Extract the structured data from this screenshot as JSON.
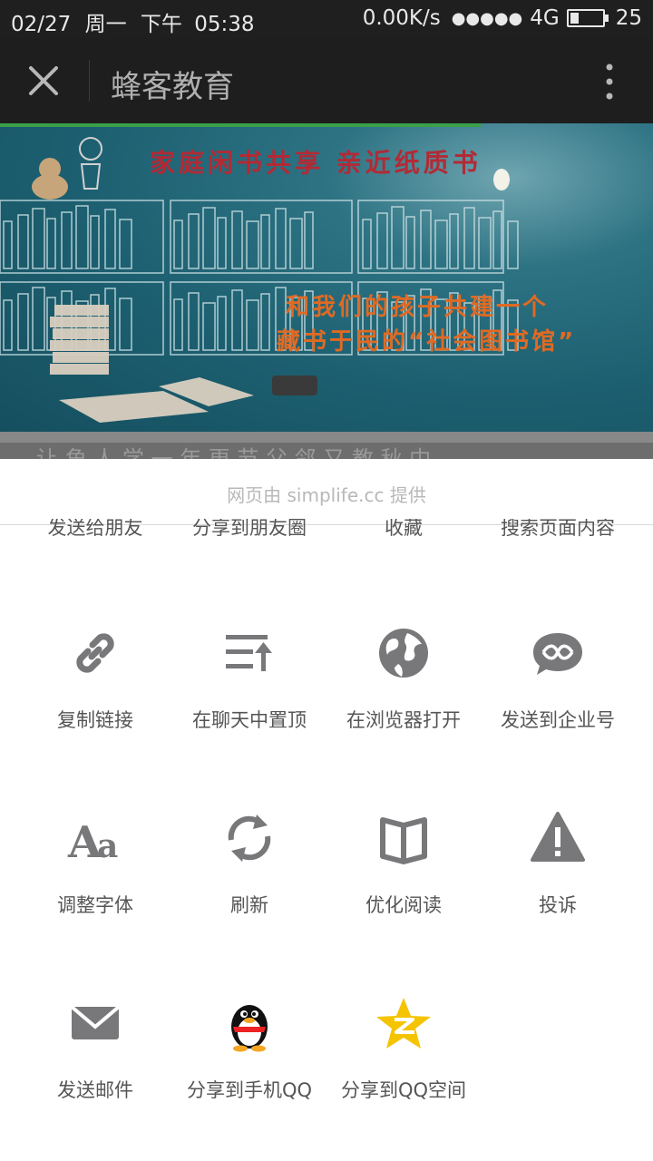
{
  "status_bar": {
    "date": "02/27",
    "weekday": "周一",
    "period": "下午",
    "time": "05:38",
    "net_speed": "0.00K/s",
    "signal": "●●●●●",
    "network": "4G",
    "battery_level": 0.25,
    "battery_text": "25"
  },
  "app_bar": {
    "title": "蜂客教育",
    "close_icon": "close-icon",
    "more_icon": "more-vertical-icon"
  },
  "banner": {
    "line1": "家庭闲书共享  亲近纸质书",
    "line2": "和我们的孩子共建一个",
    "line3": "藏书于民的“社会图书馆”"
  },
  "under_banner_text": "让 角 人 学 一 年 更 节   父 邻 又 教 秋 中",
  "share_sheet": {
    "provider": "网页由 simplife.cc 提供",
    "row0": [
      "发送给朋友",
      "分享到朋友圈",
      "收藏",
      "搜索页面内容"
    ],
    "items": [
      {
        "label": "复制链接",
        "icon": "link-icon"
      },
      {
        "label": "在聊天中置顶",
        "icon": "pin-top-icon"
      },
      {
        "label": "在浏览器打开",
        "icon": "globe-icon"
      },
      {
        "label": "发送到企业号",
        "icon": "enterprise-chat-icon"
      },
      {
        "label": "调整字体",
        "icon": "font-size-icon"
      },
      {
        "label": "刷新",
        "icon": "refresh-icon"
      },
      {
        "label": "优化阅读",
        "icon": "reader-book-icon"
      },
      {
        "label": "投诉",
        "icon": "warning-icon"
      },
      {
        "label": "发送邮件",
        "icon": "mail-icon"
      },
      {
        "label": "分享到手机QQ",
        "icon": "qq-penguin-icon"
      },
      {
        "label": "分享到QQ空间",
        "icon": "qzone-star-icon"
      }
    ]
  },
  "colors": {
    "icon_gray": "#78787a",
    "label_gray": "#555555",
    "qzone_yellow": "#f5c400"
  }
}
